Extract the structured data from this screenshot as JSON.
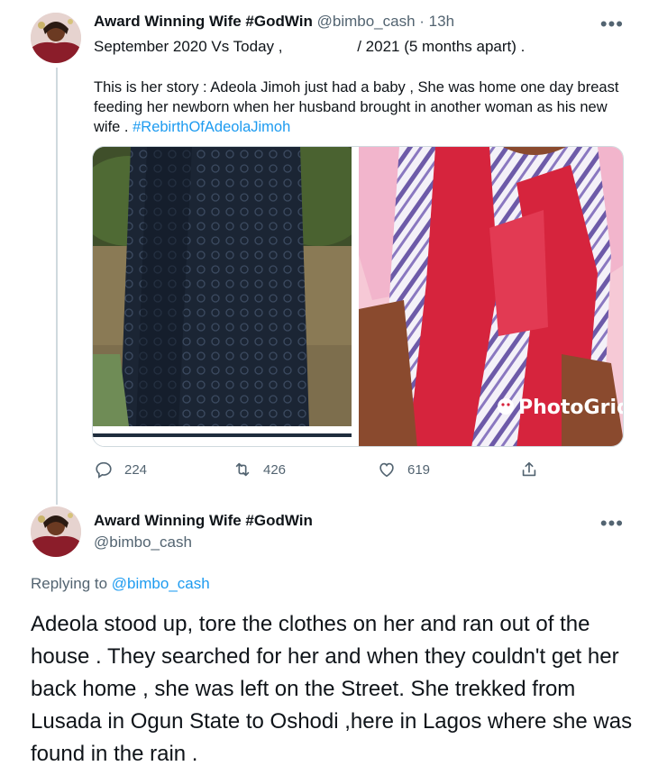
{
  "tweet1": {
    "display_name": "Award Winning Wife #GodWin",
    "handle": "@bimbo_cash",
    "age": "· 13h",
    "subline_start": "September 2020 Vs Today , ",
    "subline_mid": "/ 2021 (5 months apart) .",
    "body": "This is her story : Adeola Jimoh just had a baby , She was home one day breast feeding her newborn when her husband brought in another woman as his new wife . ",
    "hashtag": "#RebirthOfAdeolaJimoh",
    "watermark": "PhotoGrid",
    "replies": "224",
    "retweets": "426",
    "likes": "619",
    "more_menu": "•••"
  },
  "tweet2": {
    "display_name": "Award Winning Wife #GodWin",
    "handle": "@bimbo_cash",
    "replying_prefix": "Replying to ",
    "replying_to": "@bimbo_cash",
    "body": "Adeola stood up, tore the clothes on her and ran out of the house . They searched for her and when they couldn't get her back home , she was left on the Street. She trekked from Lusada in Ogun State to Oshodi ,here in Lagos where she was found in the rain .",
    "more_menu": "•••"
  },
  "colors": {
    "link": "#1d9bf0",
    "secondary_text": "#536471",
    "primary_text": "#0f1419",
    "divider": "#cfd9de"
  },
  "icons": [
    "avatar",
    "more-icon",
    "reply-icon",
    "retweet-icon",
    "like-icon",
    "share-icon"
  ]
}
